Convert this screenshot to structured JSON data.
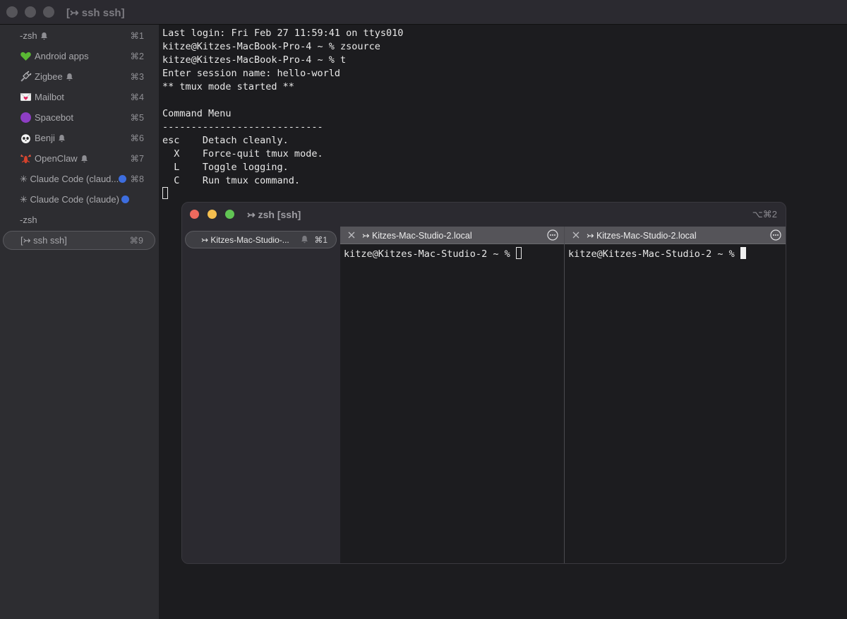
{
  "window": {
    "title": "[↣ ssh ssh]"
  },
  "sidebar": {
    "items": [
      {
        "label": "-zsh",
        "emoji": "",
        "bell": true,
        "dot": false,
        "shortcut": "⌘1"
      },
      {
        "label": "Android apps",
        "emoji": "green-heart-emoji",
        "bell": false,
        "dot": false,
        "shortcut": "⌘2"
      },
      {
        "label": "Zigbee",
        "emoji": "plug-emoji",
        "bell": true,
        "dot": false,
        "shortcut": "⌘3"
      },
      {
        "label": "Mailbot",
        "emoji": "love-letter-emoji",
        "bell": false,
        "dot": false,
        "shortcut": "⌘4"
      },
      {
        "label": "Spacebot",
        "emoji": "purple-circle-emoji",
        "bell": false,
        "dot": false,
        "shortcut": "⌘5"
      },
      {
        "label": "Benji",
        "emoji": "panda-emoji",
        "bell": true,
        "dot": false,
        "shortcut": "⌘6"
      },
      {
        "label": "OpenClaw",
        "emoji": "lobster-emoji",
        "bell": true,
        "dot": false,
        "shortcut": "⌘7"
      },
      {
        "label": "✳ Claude Code (claud...",
        "emoji": "",
        "bell": false,
        "dot": true,
        "shortcut": "⌘8"
      },
      {
        "label": "✳ Claude Code (claude)",
        "emoji": "",
        "bell": false,
        "dot": true,
        "shortcut": ""
      },
      {
        "label": "-zsh",
        "emoji": "",
        "bell": false,
        "dot": false,
        "shortcut": ""
      },
      {
        "label": "[↣ ssh ssh]",
        "emoji": "",
        "bell": false,
        "dot": false,
        "shortcut": "⌘9",
        "active": true
      }
    ]
  },
  "terminal": {
    "lines": [
      "Last login: Fri Feb 27 11:59:41 on ttys010",
      "kitze@Kitzes-MacBook-Pro-4 ~ % zsource",
      "kitze@Kitzes-MacBook-Pro-4 ~ % t",
      "Enter session name: hello-world",
      "** tmux mode started **",
      "",
      "Command Menu",
      "----------------------------",
      "esc    Detach cleanly.",
      "  X    Force-quit tmux mode.",
      "  L    Toggle logging.",
      "  C    Run tmux command."
    ]
  },
  "inner_window": {
    "title": "↣ zsh [ssh]",
    "shortcut": "⌥⌘2",
    "sidebar_item": {
      "label": "↣ Kitzes-Mac-Studio-...",
      "shortcut": "⌘1"
    },
    "panes": [
      {
        "tab_title": "↣ Kitzes-Mac-Studio-2.local",
        "prompt": "kitze@Kitzes-Mac-Studio-2 ~ % "
      },
      {
        "tab_title": "↣ Kitzes-Mac-Studio-2.local",
        "prompt": "kitze@Kitzes-Mac-Studio-2 ~ % "
      }
    ]
  },
  "colors": {
    "traffic_red": "#ed6a5e",
    "traffic_yellow": "#f5bf4f",
    "traffic_green": "#61c554",
    "unread_dot": "#3d6dde"
  }
}
